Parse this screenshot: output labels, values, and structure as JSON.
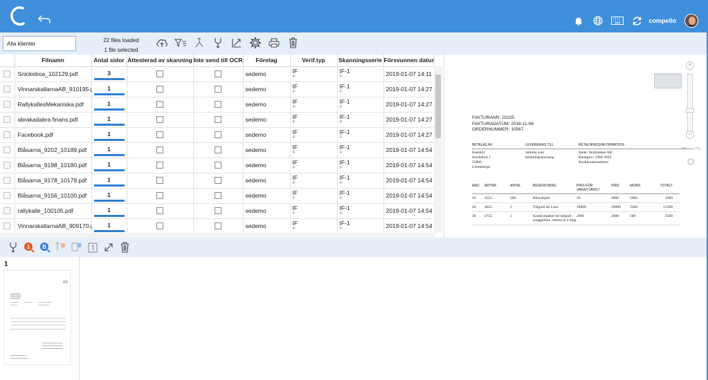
{
  "app": {
    "user_name": "compello",
    "colors": {
      "header": "#3f8fdb",
      "toolbar": "#e6eefa",
      "progress": "#2f7fd3",
      "notif_badge": "#e85a1e",
      "ocr_badge": "#3b7ddd"
    }
  },
  "toolbar": {
    "client_select": "Alla klienter",
    "files_loaded": "22 files loaded",
    "files_selected": "1 file selected",
    "icons": [
      "cloud-upload-icon",
      "filter-icon",
      "split-icon",
      "merge-icon",
      "scan-icon",
      "settings-icon",
      "print-icon",
      "delete-icon"
    ]
  },
  "grid": {
    "columns": [
      "Filnamn",
      "Antal sidor",
      "Attesterad av skanning",
      "Inte send till OCR",
      "Företag",
      "Verif.typ",
      "Skanningsserie",
      "Försvunnen datum"
    ],
    "rows": [
      {
        "name": "Snickeboa_102129.pdf",
        "pages": "3",
        "company": "sedemo",
        "verif": "IF",
        "verif_sub": "IF",
        "serie": "IF-1",
        "serie_sub": "IF",
        "date": "2019-01-07 14:11"
      },
      {
        "name": "VinnarskallarnaAB_910195.pdf",
        "pages": "1",
        "company": "sedemo",
        "verif": "IF",
        "verif_sub": "IF",
        "serie": "IF-1",
        "serie_sub": "IF",
        "date": "2019-01-07 14:27"
      },
      {
        "name": "RallykallesMekaniska.pdf",
        "pages": "1",
        "company": "sedemo",
        "verif": "IF",
        "verif_sub": "IF",
        "serie": "IF-1",
        "serie_sub": "IF",
        "date": "2019-01-07 14:27"
      },
      {
        "name": "abrakadabra finans.pdf",
        "pages": "1",
        "company": "sedemo",
        "verif": "IF",
        "verif_sub": "IF",
        "serie": "IF-1",
        "serie_sub": "IF",
        "date": "2019-01-07 14:27"
      },
      {
        "name": "Facebook.pdf",
        "pages": "1",
        "company": "sedemo",
        "verif": "IF",
        "verif_sub": "IF",
        "serie": "IF-1",
        "serie_sub": "IF",
        "date": "2019-01-07 14:27"
      },
      {
        "name": "Blåsarna_9202_10189.pdf",
        "pages": "1",
        "company": "sedemo",
        "verif": "IF",
        "verif_sub": "IF",
        "serie": "IF-1",
        "serie_sub": "IF",
        "date": "2019-01-07 14:54"
      },
      {
        "name": "Blåsarna_9198_10180.pdf",
        "pages": "1",
        "company": "sedemo",
        "verif": "IF",
        "verif_sub": "IF",
        "serie": "IF-1",
        "serie_sub": "IF",
        "date": "2019-01-07 14:54"
      },
      {
        "name": "Blåsarna_9178_10178.pdf",
        "pages": "1",
        "company": "sedemo",
        "verif": "IF",
        "verif_sub": "IF",
        "serie": "IF-1",
        "serie_sub": "IF",
        "date": "2019-01-07 14:54"
      },
      {
        "name": "Blåsarna_9156_10100.pdf",
        "pages": "1",
        "company": "sedemo",
        "verif": "IF",
        "verif_sub": "IF",
        "serie": "IF-1",
        "serie_sub": "IF",
        "date": "2019-01-07 14:54"
      },
      {
        "name": "rallykalle_100105.pdf",
        "pages": "1",
        "company": "sedemo",
        "verif": "IF",
        "verif_sub": "IF",
        "serie": "IF-1",
        "serie_sub": "IF",
        "date": "2019-01-07 14:54"
      },
      {
        "name": "VinnarskallarnaAB_909170.pdf",
        "pages": "1",
        "company": "sedemo",
        "verif": "IF",
        "verif_sub": "IF",
        "serie": "IF-1",
        "serie_sub": "IF",
        "date": "2019-01-07 14:54"
      }
    ]
  },
  "preview": {
    "invoice_number": "FAKTURANR: 10225",
    "invoice_date": "FAKTURADATUM: 2018-11-06",
    "order_number": "ORDERNUMMER: 10567",
    "billed_by_header": "BETALAS AV",
    "billed_by_lines": [
      "Eeeemil",
      "Snickeboa 1",
      "52860",
      "Lönneberga"
    ],
    "delivered_to_header": "LEVERERAS TILL",
    "delivered_to_lines": [
      "Samma som",
      "betalningsansvarig"
    ],
    "payment_header": "BETALNINGSINFORMATION",
    "payment_lines": [
      "Bank: Storbanken AB",
      "Bankgiro: 5960-3029",
      "Bankkontonummer:"
    ],
    "table_headers": [
      "RAD",
      "ARTNR",
      "ANTAL",
      "BESKRIVNING",
      "PRIS FÖR VARA/TJÄNST",
      "PRIS",
      "MOMS",
      "TOTALT"
    ],
    "table_rows": [
      [
        "10",
        "4555",
        "200",
        "Börsslöjdd",
        "20",
        "4000",
        "1000",
        "5000"
      ],
      [
        "20",
        "4655",
        "1",
        "Täljpull de Luxe",
        "10000",
        "10000",
        "2500",
        "12500"
      ],
      [
        "30",
        "4755",
        "1",
        "Komfortpaket till täljpull -snuggällare -steren m 4 högt",
        "2000",
        "2000",
        "500",
        "2500"
      ]
    ]
  },
  "bottom_toolbar": {
    "icons": [
      "merge-icon",
      "ocr-icon",
      "ocr-b-icon",
      "rotate-icon",
      "move-pages-icon",
      "page-number-icon",
      "expand-icon",
      "delete-icon"
    ],
    "ocr_badge": "1",
    "b_badge": "B"
  },
  "pages_panel": {
    "page_number": "1"
  }
}
